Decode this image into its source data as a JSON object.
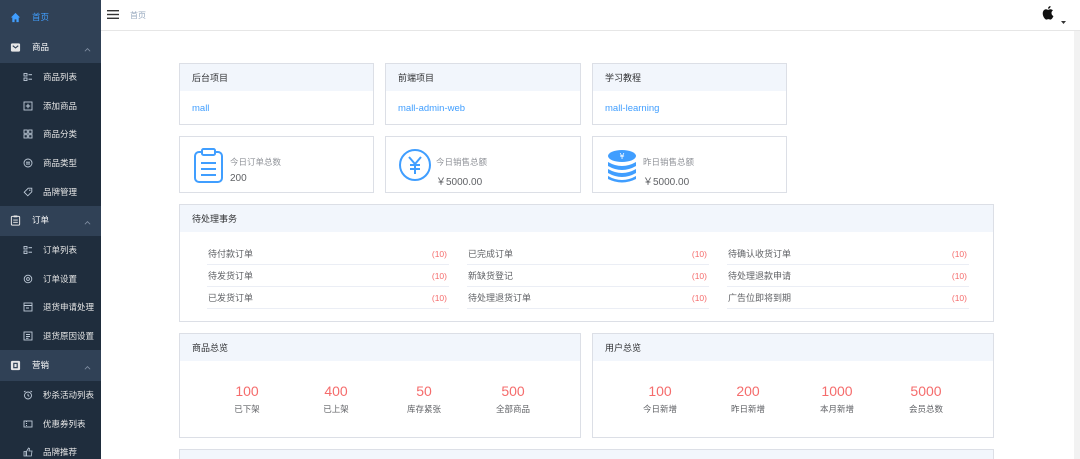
{
  "sidebar": {
    "home": "首页",
    "groups": [
      {
        "label": "商品",
        "icon": "product-icon",
        "items": [
          "商品列表",
          "添加商品",
          "商品分类",
          "商品类型",
          "品牌管理"
        ]
      },
      {
        "label": "订单",
        "icon": "order-icon",
        "items": [
          "订单列表",
          "订单设置",
          "退货申请处理",
          "退货原因设置"
        ]
      },
      {
        "label": "营销",
        "icon": "marketing-icon",
        "items": [
          "秒杀活动列表",
          "优惠券列表",
          "品牌推荐"
        ]
      }
    ]
  },
  "header": {
    "breadcrumb": "首页"
  },
  "projects": [
    {
      "title": "后台项目",
      "link": "mall"
    },
    {
      "title": "前端项目",
      "link": "mall-admin-web"
    },
    {
      "title": "学习教程",
      "link": "mall-learning"
    }
  ],
  "stats": [
    {
      "title": "今日订单总数",
      "value": "200"
    },
    {
      "title": "今日销售总额",
      "value": "￥5000.00"
    },
    {
      "title": "昨日销售总额",
      "value": "￥5000.00"
    }
  ],
  "todo": {
    "title": "待处理事务",
    "items": [
      {
        "label": "待付款订单",
        "count": "(10)"
      },
      {
        "label": "已完成订单",
        "count": "(10)"
      },
      {
        "label": "待确认收货订单",
        "count": "(10)"
      },
      {
        "label": "待发货订单",
        "count": "(10)"
      },
      {
        "label": "新缺货登记",
        "count": "(10)"
      },
      {
        "label": "待处理退款申请",
        "count": "(10)"
      },
      {
        "label": "已发货订单",
        "count": "(10)"
      },
      {
        "label": "待处理退货订单",
        "count": "(10)"
      },
      {
        "label": "广告位即将到期",
        "count": "(10)"
      }
    ]
  },
  "product_overview": {
    "title": "商品总览",
    "items": [
      {
        "num": "100",
        "label": "已下架"
      },
      {
        "num": "400",
        "label": "已上架"
      },
      {
        "num": "50",
        "label": "库存紧张"
      },
      {
        "num": "500",
        "label": "全部商品"
      }
    ]
  },
  "user_overview": {
    "title": "用户总览",
    "items": [
      {
        "num": "100",
        "label": "今日新增"
      },
      {
        "num": "200",
        "label": "昨日新增"
      },
      {
        "num": "1000",
        "label": "本月新增"
      },
      {
        "num": "5000",
        "label": "会员总数"
      }
    ]
  },
  "colors": {
    "sidebar_bg": "#304156",
    "submenu_bg": "#1f2d3d",
    "accent": "#409eff",
    "danger": "#f56c6c",
    "panel_head_bg": "#f2f6fc"
  }
}
